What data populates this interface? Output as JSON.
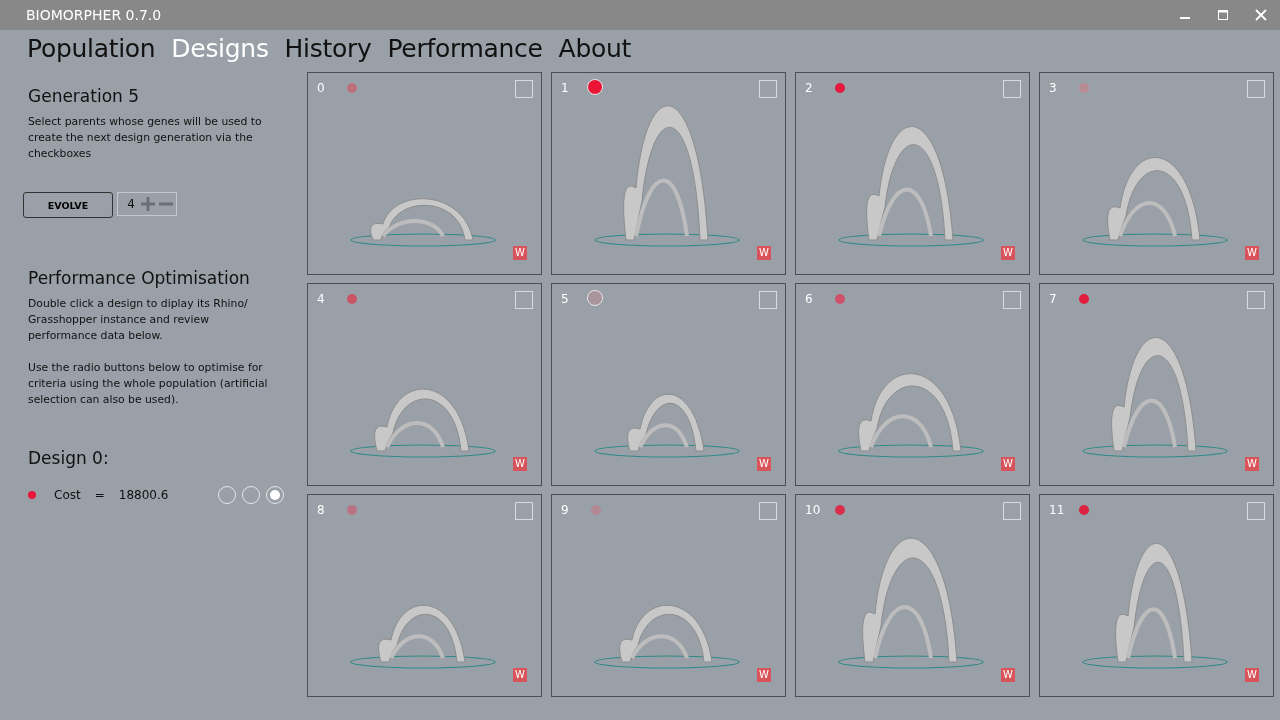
{
  "window": {
    "title": "BIOMORPHER 0.7.0"
  },
  "tabs": [
    {
      "label": "Population",
      "selected": false
    },
    {
      "label": "Designs",
      "selected": true
    },
    {
      "label": "History",
      "selected": false
    },
    {
      "label": "Performance",
      "selected": false
    },
    {
      "label": "About",
      "selected": false
    }
  ],
  "sidebar": {
    "generation_title": "Generation 5",
    "generation_text": "Select parents whose genes will be used to create the next design generation via the checkboxes",
    "evolve_button": "EVOLVE",
    "stepper_value": "4",
    "optimisation_title": "Performance Optimisation",
    "optimisation_text_1": "Double click a design to diplay its Rhino/ Grasshopper instance and review performance data below.",
    "optimisation_text_2": "Use the radio buttons below to optimise for criteria using the whole population (artificial selection can also be used).",
    "design_title": "Design 0:",
    "criteria": [
      {
        "color": "#e8173c",
        "name": "Cost",
        "equals": "=",
        "value": "18800.6",
        "radios": [
          {
            "selected": false
          },
          {
            "selected": false
          },
          {
            "selected": true
          }
        ]
      }
    ]
  },
  "designs": [
    {
      "label": "0",
      "color": "#b8707c",
      "ringed": false,
      "checked": false,
      "badge": "W"
    },
    {
      "label": "1",
      "color": "#ea1535",
      "ringed": true,
      "checked": false,
      "badge": "W"
    },
    {
      "label": "2",
      "color": "#e41a3c",
      "ringed": false,
      "checked": false,
      "badge": "W"
    },
    {
      "label": "3",
      "color": "#b88a94",
      "ringed": false,
      "checked": false,
      "badge": "W"
    },
    {
      "label": "4",
      "color": "#c95468",
      "ringed": false,
      "checked": false,
      "badge": "W"
    },
    {
      "label": "5",
      "color": "#a8949a",
      "ringed": true,
      "checked": false,
      "badge": "W"
    },
    {
      "label": "6",
      "color": "#d0506a",
      "ringed": false,
      "checked": false,
      "badge": "W"
    },
    {
      "label": "7",
      "color": "#e21e40",
      "ringed": false,
      "checked": false,
      "badge": "W"
    },
    {
      "label": "8",
      "color": "#b87482",
      "ringed": false,
      "checked": false,
      "badge": "W"
    },
    {
      "label": "9",
      "color": "#b28892",
      "ringed": false,
      "checked": false,
      "badge": "W"
    },
    {
      "label": "10",
      "color": "#d82f4e",
      "ringed": false,
      "checked": false,
      "badge": "W"
    },
    {
      "label": "11",
      "color": "#dc2242",
      "ringed": false,
      "checked": false,
      "badge": "W"
    }
  ]
}
